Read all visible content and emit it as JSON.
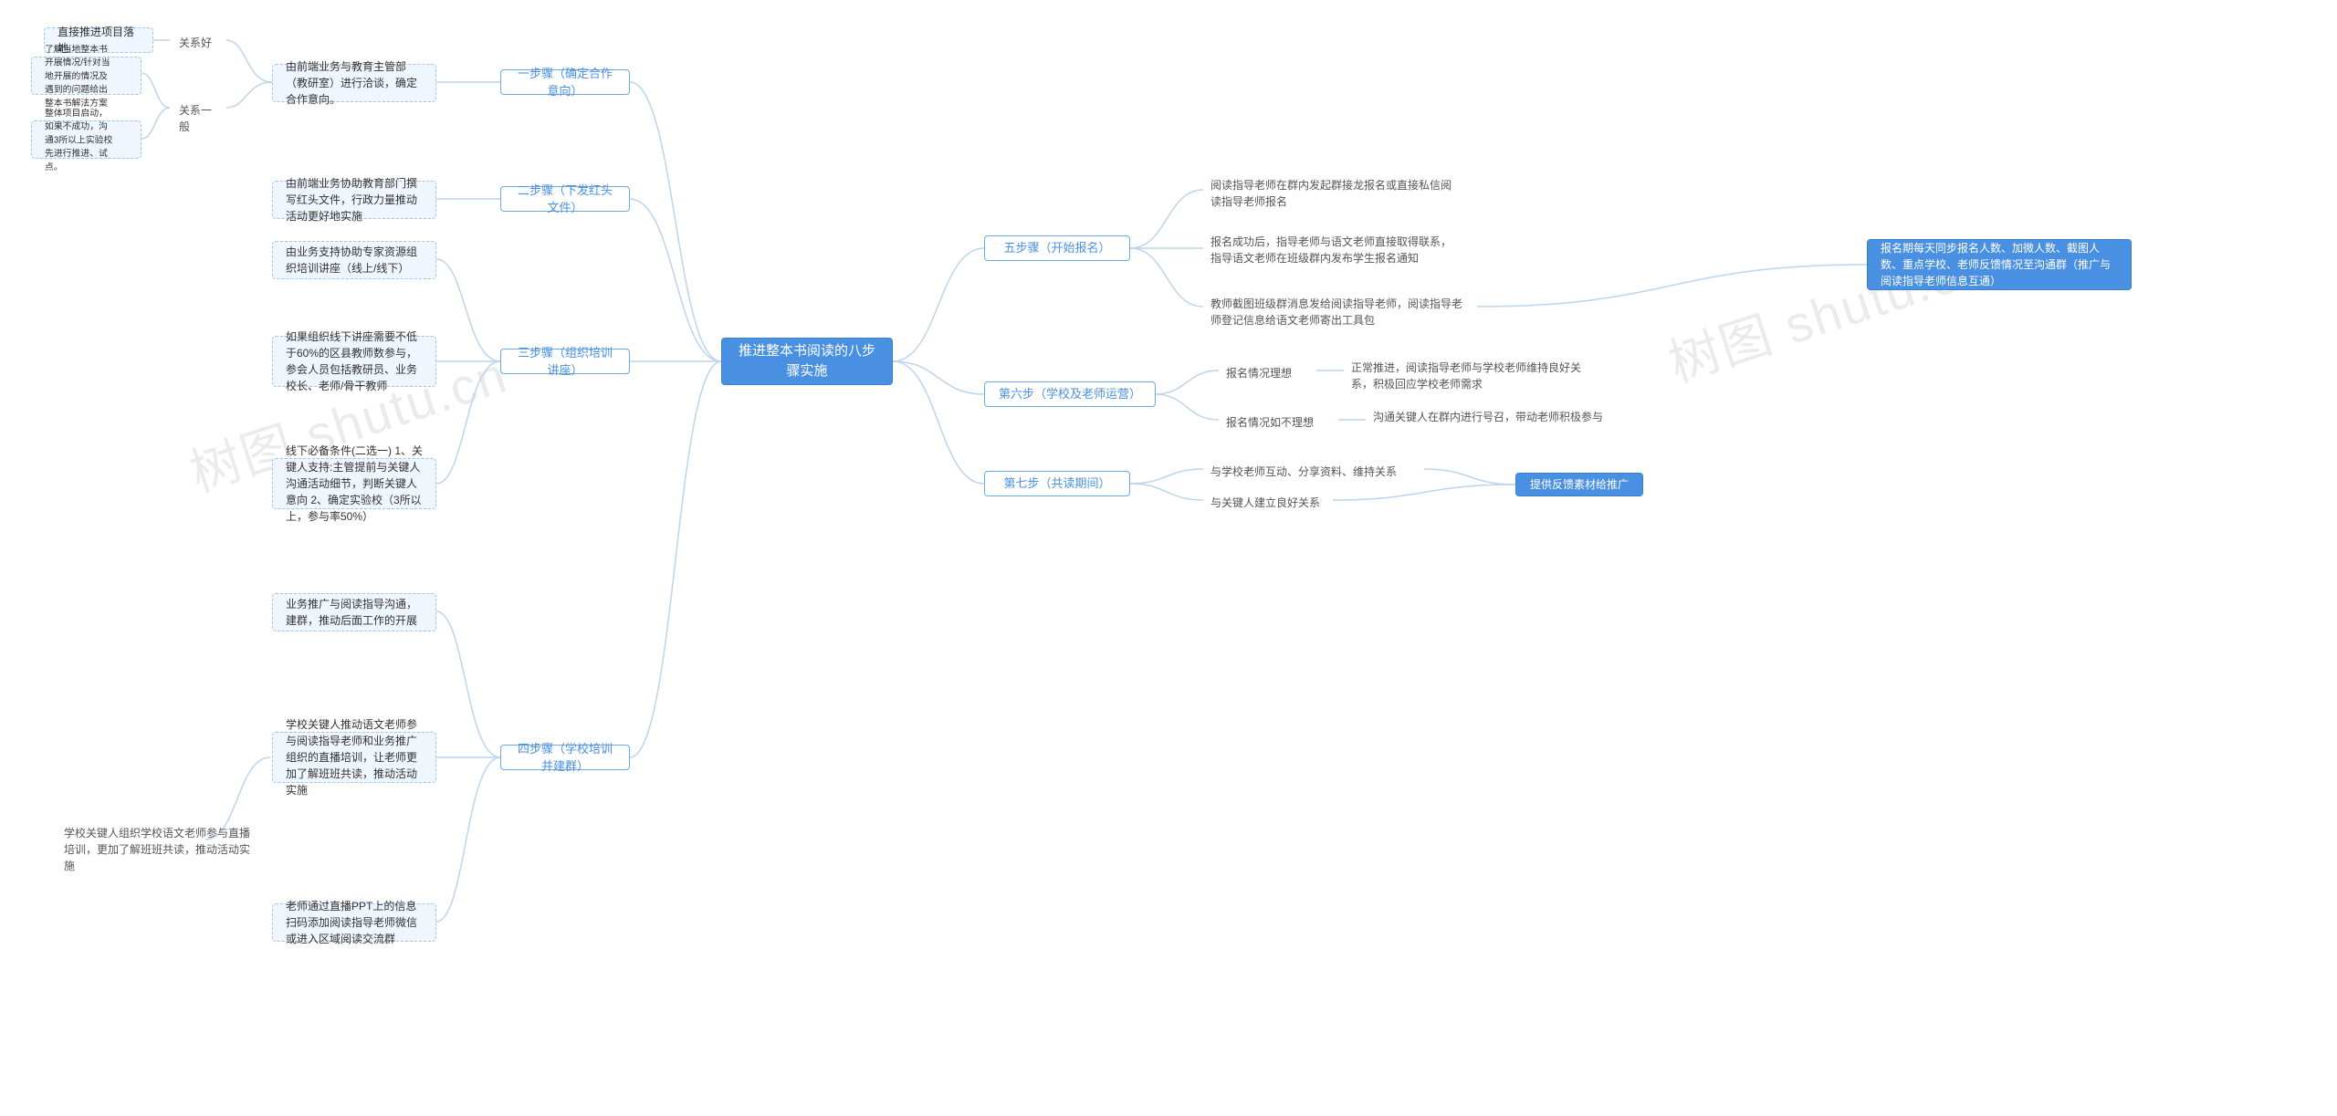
{
  "center": "推进整本书阅读的八步骤实施",
  "left": {
    "step1": {
      "label": "一步骤（确定合作意向）",
      "main": "由前端业务与教育主管部（教研室）进行洽谈，确定合作意向。",
      "good": "关系好",
      "good_detail": "直接推进项目落地",
      "normal": "关系一般",
      "normal_d1": "了解当地整本书开展情况/针对当地开展的情况及遇到的问题给出整本书解法方案",
      "normal_d2": "整体项目启动，如果不成功，沟通3所以上实验校先进行推进、试点。"
    },
    "step2": {
      "label": "二步骤（下发红头文件）",
      "main": "由前端业务协助教育部门撰写红头文件，行政力量推动活动更好地实施"
    },
    "step3": {
      "label": "三步骤（组织培训讲座）",
      "d1": "由业务支持协助专家资源组织培训讲座（线上/线下）",
      "d2": "如果组织线下讲座需要不低于60%的区县教师数参与，参会人员包括教研员、业务校长、老师/骨干教师",
      "d3": "线下必备条件(二选一) 1、关键人支持:主管提前与关键人沟通活动细节，判断关键人意向 2、确定实验校（3所以上，参与率50%）"
    },
    "step4": {
      "label": "四步骤（学校培训并建群）",
      "d1": "业务推广与阅读指导沟通，建群，推动后面工作的开展",
      "d2": "学校关键人推动语文老师参与阅读指导老师和业务推广组织的直播培训，让老师更加了解班班共读，推动活动实施",
      "d2_sub": "学校关键人组织学校语文老师参与直播培训，更加了解班班共读，推动活动实施",
      "d3": "老师通过直播PPT上的信息扫码添加阅读指导老师微信或进入区域阅读交流群"
    }
  },
  "right": {
    "step5": {
      "label": "五步骤（开始报名）",
      "d1": "阅读指导老师在群内发起群接龙报名或直接私信阅读指导老师报名",
      "d2": "报名成功后，指导老师与语文老师直接取得联系，指导语文老师在班级群内发布学生报名通知",
      "d3": "教师截图班级群消息发给阅读指导老师，阅读指导老师登记信息给语文老师寄出工具包",
      "d3_ext": "报名期每天同步报名人数、加微人数、截图人数、重点学校、老师反馈情况至沟通群（推广与阅读指导老师信息互通）"
    },
    "step6": {
      "label": "第六步（学校及老师运营）",
      "good": "报名情况理想",
      "good_d": "正常推进，阅读指导老师与学校老师维持良好关系，积极回应学校老师需求",
      "bad": "报名情况如不理想",
      "bad_d": "沟通关键人在群内进行号召，带动老师积极参与"
    },
    "step7": {
      "label": "第七步（共读期间）",
      "d1": "与学校老师互动、分享资料、维持关系",
      "d2": "与关键人建立良好关系",
      "ext": "提供反馈素材给推广"
    }
  },
  "watermarks": [
    "树图 shutu.cn",
    "树图 shutu.cn"
  ]
}
